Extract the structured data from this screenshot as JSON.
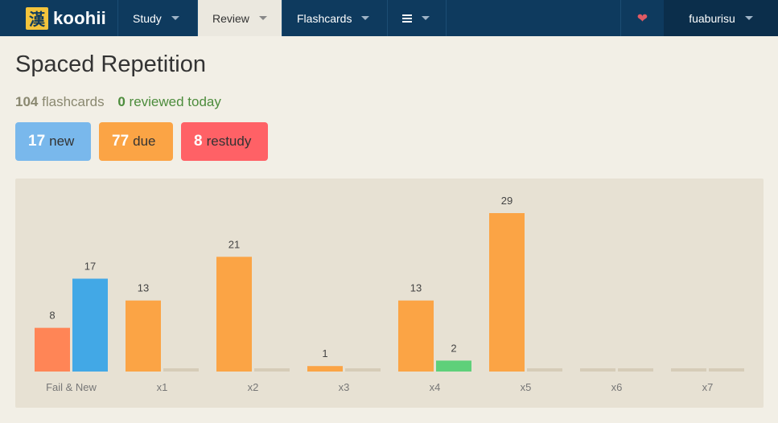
{
  "navbar": {
    "logo_kanji": "漢",
    "logo_text": "koohii",
    "study_label": "Study",
    "review_label": "Review",
    "flashcards_label": "Flashcards",
    "heart_icon": "heart-icon",
    "username": "fuaburisu"
  },
  "page": {
    "title": "Spaced Repetition"
  },
  "stats": {
    "flashcards_count": "104",
    "flashcards_label": "flashcards",
    "reviewed_count": "0",
    "reviewed_label": "reviewed today"
  },
  "pills": {
    "new_count": "17",
    "new_label": "new",
    "due_count": "77",
    "due_label": "due",
    "restudy_count": "8",
    "restudy_label": "restudy"
  },
  "chart_data": {
    "type": "bar",
    "categories": [
      "Fail & New",
      "x1",
      "x2",
      "x3",
      "x4",
      "x5",
      "x6",
      "x7"
    ],
    "series": [
      {
        "color": "#ff8556",
        "values": [
          8,
          null,
          null,
          null,
          null,
          null,
          null,
          null
        ]
      },
      {
        "color": "#fba445",
        "values": [
          null,
          13,
          21,
          1,
          13,
          29,
          0,
          0
        ]
      },
      {
        "color": "#42a8e6",
        "values": [
          17,
          null,
          null,
          null,
          null,
          null,
          null,
          null
        ]
      },
      {
        "color": "#5fd07a",
        "values": [
          null,
          0,
          0,
          0,
          2,
          0,
          0,
          0
        ]
      }
    ],
    "ylim": [
      0,
      29
    ]
  },
  "colors": {
    "navbar": "#0e3a5e",
    "fail": "#ff8556",
    "due": "#fba445",
    "new": "#42a8e6",
    "learned": "#5fd07a",
    "empty": "#d6ccb8"
  }
}
